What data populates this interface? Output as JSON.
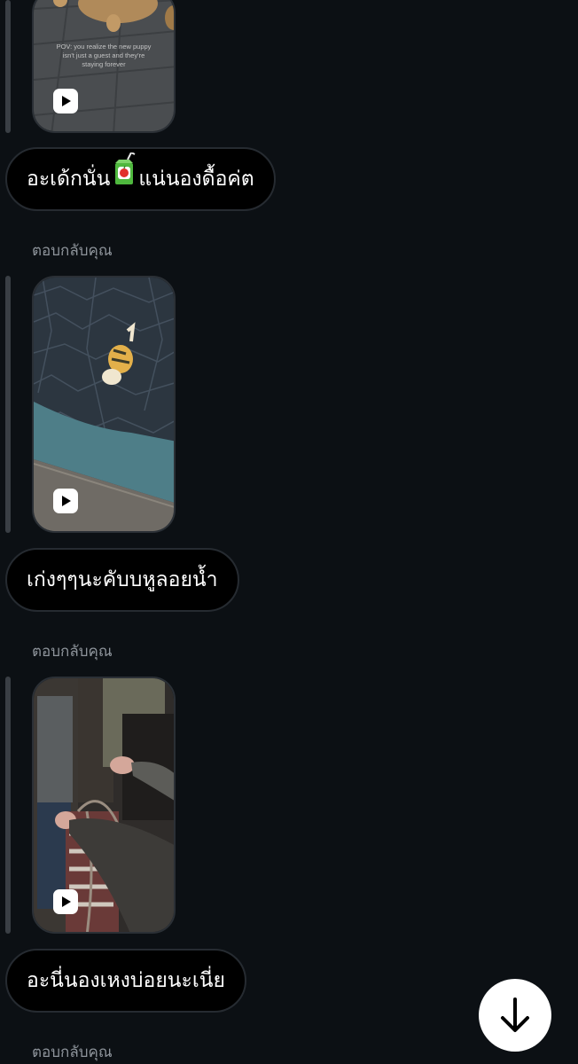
{
  "messages": [
    {
      "video_caption": "POV: you realize the new puppy isn't just a guest and they're staying forever",
      "text_before_emoji": "อะเด้กนั่น",
      "emoji": "juice-box-icon",
      "text_after_emoji": "แน่นองดื้อค่ต"
    },
    {
      "reply_label": "ตอบกลับคุณ",
      "text": "เก่งๆๆนะคับบหูลอยน้ำ"
    },
    {
      "reply_label": "ตอบกลับคุณ",
      "text": "อะนี่นองเหงบ่อยนะเนี่ย"
    },
    {
      "reply_label": "ตอบกลับคุณ"
    }
  ],
  "scroll_button": {
    "icon": "arrow-down-icon"
  },
  "colors": {
    "background": "#0c1014",
    "bubble": "#000000",
    "label": "#8e949b",
    "reply_line": "#3a3f45"
  }
}
